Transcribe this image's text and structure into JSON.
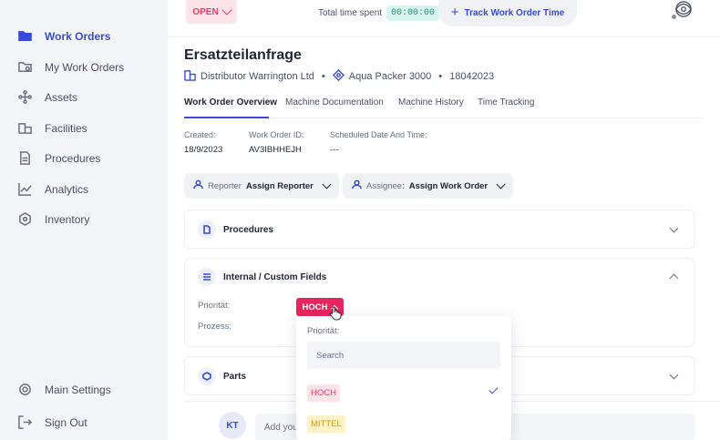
{
  "sidebar": {
    "items": [
      {
        "label": "Work Orders",
        "icon": "folder-icon",
        "active": true
      },
      {
        "label": "My Work Orders",
        "icon": "my-work-orders-icon"
      },
      {
        "label": "Assets",
        "icon": "assets-icon"
      },
      {
        "label": "Facilities",
        "icon": "facilities-icon"
      },
      {
        "label": "Procedures",
        "icon": "procedures-icon"
      },
      {
        "label": "Analytics",
        "icon": "analytics-icon"
      },
      {
        "label": "Inventory",
        "icon": "inventory-icon"
      }
    ],
    "bottom": [
      {
        "label": "Main Settings",
        "icon": "gear-icon"
      },
      {
        "label": "Sign Out",
        "icon": "sign-out-icon"
      }
    ]
  },
  "header": {
    "status": "OPEN",
    "time_label": "Total time spent",
    "time_value": "00:00:00",
    "track_label": "Track Work Order Time"
  },
  "work_order": {
    "title": "Ersatzteilanfrage",
    "distributor": "Distributor Warrington Ltd",
    "machine": "Aqua Packer 3000",
    "serial": "18042023"
  },
  "tabs": [
    "Work Order Overview",
    "Machine Documentation",
    "Machine History",
    "Time Tracking"
  ],
  "info": {
    "created_label": "Created:",
    "created_value": "18/9/2023",
    "id_label": "Work Order ID:",
    "id_value": "AV3IBHHEJH",
    "scheduled_label": "Scheduled Date And Time:",
    "scheduled_value": "---"
  },
  "reporter": {
    "label": "Reporter",
    "value": "Assign Reporter"
  },
  "assignee": {
    "label": "Assignee:",
    "value": "Assign Work Order"
  },
  "panels": {
    "procedures": "Procedures",
    "custom_fields": "Internal / Custom Fields",
    "parts": "Parts"
  },
  "custom_fields": {
    "priority_label": "Priorität:",
    "priority_value": "HOCH",
    "process_label": "Prozess:"
  },
  "dropdown": {
    "label": "Priorität:",
    "search_placeholder": "Search",
    "options": [
      {
        "label": "HOCH",
        "selected": true,
        "color": "#e53c66"
      },
      {
        "label": "MITTEL",
        "selected": false,
        "color": "#c99d12"
      }
    ]
  },
  "comment": {
    "avatar": "KT",
    "placeholder": "Add your comment"
  },
  "colors": {
    "accent": "#3a4ad8",
    "priority_high": "#e8245e",
    "priority_medium": "#c99d12"
  }
}
